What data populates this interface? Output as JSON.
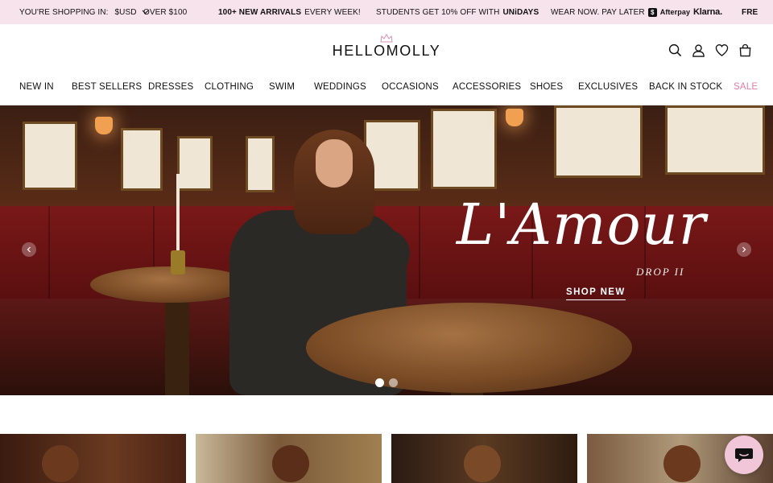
{
  "announcement": {
    "currency_label": "YOU'RE SHOPPING IN:",
    "currency_value": "$USD",
    "msg_shipping": "OVER $100",
    "msg_arrivals_bold": "100+ NEW ARRIVALS",
    "msg_arrivals_rest": "EVERY WEEK!",
    "msg_students": "STUDENTS GET 10% OFF WITH",
    "msg_students_brand": "UNiDAYS",
    "msg_paylater": "WEAR NOW. PAY LATER",
    "afterpay_badge": "$",
    "afterpay": "Afterpay",
    "klarna": "Klarna.",
    "msg_cut": "FRE"
  },
  "header": {
    "logo": "HELLOMOLLY"
  },
  "nav": {
    "items": [
      "NEW IN",
      "BEST SELLERS",
      "DRESSES",
      "CLOTHING",
      "SWIM",
      "WEDDINGS",
      "OCCASIONS",
      "ACCESSORIES",
      "SHOES",
      "EXCLUSIVES",
      "BACK IN STOCK",
      "SALE"
    ]
  },
  "hero": {
    "headline": "L'Amour",
    "subline": "DROP II",
    "cta": "SHOP NEW",
    "slide_count": 2,
    "active_slide": 1
  },
  "colors": {
    "announcement_bg": "#f7e3ec",
    "sale": "#e27aa8",
    "chat_bubble": "#f0c6d8"
  },
  "icons": {
    "header": [
      "search-icon",
      "account-icon",
      "wishlist-heart-icon",
      "cart-bag-icon"
    ],
    "slider": [
      "chevron-left-icon",
      "chevron-right-icon"
    ],
    "chat": "chat-bubble-icon"
  }
}
